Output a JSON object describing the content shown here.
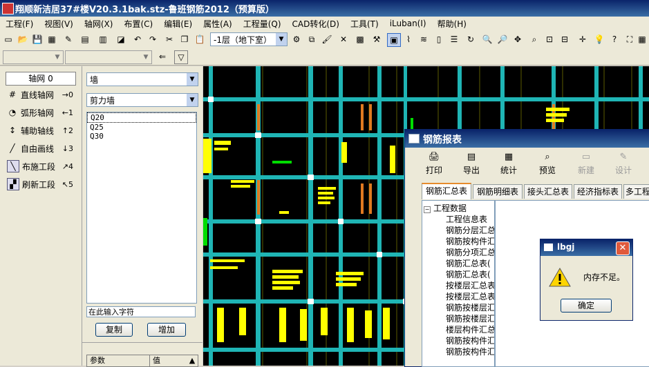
{
  "app": {
    "title": "翔顺新洁居37#楼V20.3.1bak.stz-鲁班钢筋2012（预算版）"
  },
  "menu": [
    "工程(F)",
    "视图(V)",
    "轴网(X)",
    "布置(C)",
    "编辑(E)",
    "属性(A)",
    "工程量(Q)",
    "CAD转化(D)",
    "工具(T)",
    "iLuban(I)",
    "帮助(H)"
  ],
  "toolbar": {
    "floor_value": "-1层（地下室）"
  },
  "left_panel": {
    "tab_label": "轴网 0",
    "items": [
      {
        "label": "直线轴网",
        "shortcut": "→0",
        "icon": "grid-icon"
      },
      {
        "label": "弧形轴网",
        "shortcut": "←1",
        "icon": "arc-grid-icon"
      },
      {
        "label": "辅助轴线",
        "shortcut": "↑2",
        "icon": "aux-axis-icon"
      },
      {
        "label": "自由画线",
        "shortcut": "↓3",
        "icon": "pen-icon"
      },
      {
        "label": "布施工段",
        "shortcut": "↗4",
        "icon": "section-icon"
      },
      {
        "label": "刷新工段",
        "shortcut": "↖5",
        "icon": "refresh-section-icon"
      }
    ]
  },
  "mid_panel": {
    "category": "墙",
    "type": "剪力墙",
    "grades": [
      "Q20",
      "Q25",
      "Q30"
    ],
    "filter_placeholder": "在此输入字符",
    "copy_label": "复制",
    "add_label": "增加",
    "param_header": "参数",
    "value_header": "值"
  },
  "report": {
    "title": "钢筋报表",
    "buttons": [
      {
        "label": "打印",
        "icon": "print-icon"
      },
      {
        "label": "导出",
        "icon": "export-icon"
      },
      {
        "label": "统计",
        "icon": "stats-icon"
      },
      {
        "label": "预览",
        "icon": "preview-icon"
      },
      {
        "label": "新建",
        "icon": "new-icon"
      },
      {
        "label": "设计",
        "icon": "design-icon"
      }
    ],
    "tabs": [
      "钢筋汇总表",
      "钢筋明细表",
      "接头汇总表",
      "经济指标表",
      "多工程"
    ],
    "tree_root": "工程数据",
    "tree_items": [
      "工程信息表",
      "钢筋分层汇总",
      "钢筋按构件汇",
      "钢筋分项汇总",
      "钢筋汇总表(",
      "钢筋汇总表(",
      "按楼层汇总表",
      "按楼层汇总表",
      "钢筋按楼层汇",
      "钢筋按楼层汇",
      "楼层构件汇总",
      "钢筋按构件汇",
      "钢筋按构件汇"
    ]
  },
  "msgbox": {
    "title": "lbgj",
    "message": "内存不足。",
    "ok_label": "确定"
  },
  "colors": {
    "beam": "#1fb5b5",
    "wall": "#e07a20",
    "label": "#ffff00",
    "canvas": "#000000"
  }
}
